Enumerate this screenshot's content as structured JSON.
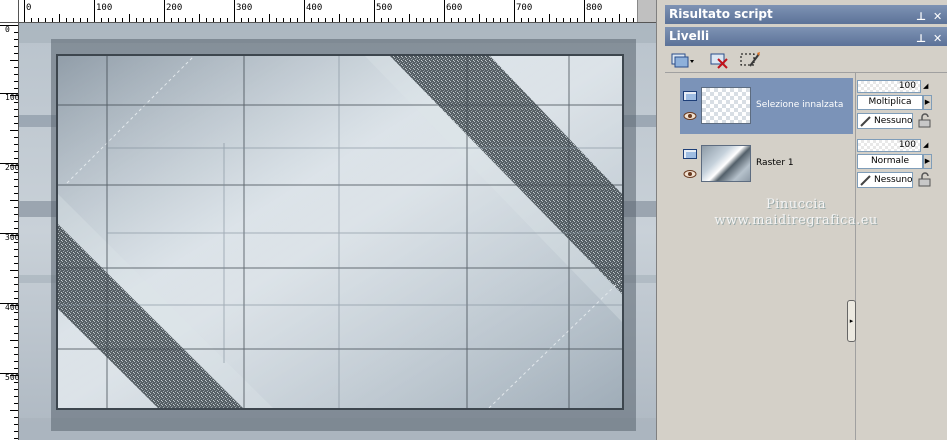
{
  "rulers": {
    "horizontal_labels": [
      "0",
      "100",
      "200",
      "300",
      "400",
      "500",
      "600",
      "700",
      "800"
    ],
    "vertical_labels": [
      "0",
      "100",
      "200",
      "300",
      "400",
      "500"
    ]
  },
  "panels": {
    "script_output": {
      "title": "Risultato script"
    },
    "layers": {
      "title": "Livelli",
      "toolbar": [
        "new-layer-icon",
        "delete-layer-icon",
        "edit-selection-icon"
      ],
      "rows": [
        {
          "name": "Selezione innalzata",
          "opacity": "100",
          "blend_mode": "Moltiplica",
          "mask": "Nessuno",
          "selected": true
        },
        {
          "name": "Raster 1",
          "opacity": "100",
          "blend_mode": "Normale",
          "mask": "Nessuno",
          "selected": false
        }
      ]
    }
  },
  "watermark": {
    "line1": "Pinuccia",
    "line2": "www.maidiregrafica.eu"
  },
  "colors": {
    "selection_highlight": "#7b93b8",
    "titlebar": "#6a80a6",
    "panel_bg": "#d4d0c8",
    "canvas_steel": "#b8c7d1",
    "dark_band": "#4a5359"
  }
}
